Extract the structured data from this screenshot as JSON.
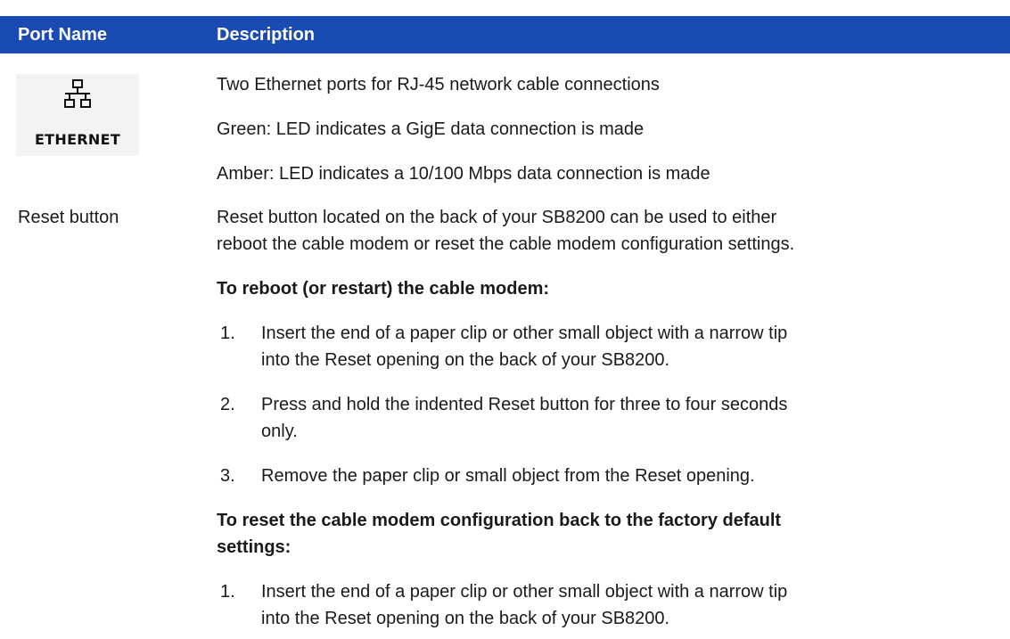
{
  "table": {
    "headers": {
      "port_name": "Port Name",
      "description": "Description"
    },
    "ethernet": {
      "icon": "ethernet-network-icon",
      "icon_label": "ETHERNET",
      "lines": [
        "Two Ethernet ports for RJ-45 network cable connections",
        "Green: LED indicates a GigE data connection is made",
        "Amber: LED indicates a 10/100 Mbps data connection is made"
      ]
    },
    "reset": {
      "port_name": "Reset button",
      "intro_lines": [
        "Reset button located on the back of your SB8200 can be used to either",
        "reboot the cable modem or reset the cable modem configuration settings."
      ],
      "reboot_heading": "To reboot (or restart) the cable modem:",
      "reboot_steps": [
        {
          "num": "1.",
          "lines": [
            "Insert the end of a paper clip or other small object with a narrow tip",
            "into the Reset opening on the back of your SB8200."
          ]
        },
        {
          "num": "2.",
          "lines": [
            "Press and hold the indented Reset button for three to four seconds",
            "only."
          ]
        },
        {
          "num": "3.",
          "lines": [
            "Remove the paper clip or small object from the Reset opening."
          ]
        }
      ],
      "factory_heading_lines": [
        "To reset the cable modem configuration back to the factory default",
        "settings:"
      ],
      "factory_steps": [
        {
          "num": "1.",
          "lines": [
            "Insert the end of a paper clip or other small object with a narrow tip",
            "into the Reset opening on the back of your SB8200."
          ]
        }
      ]
    }
  },
  "colors": {
    "header_bg": "#1a4bb3",
    "header_text": "#ffffff"
  }
}
